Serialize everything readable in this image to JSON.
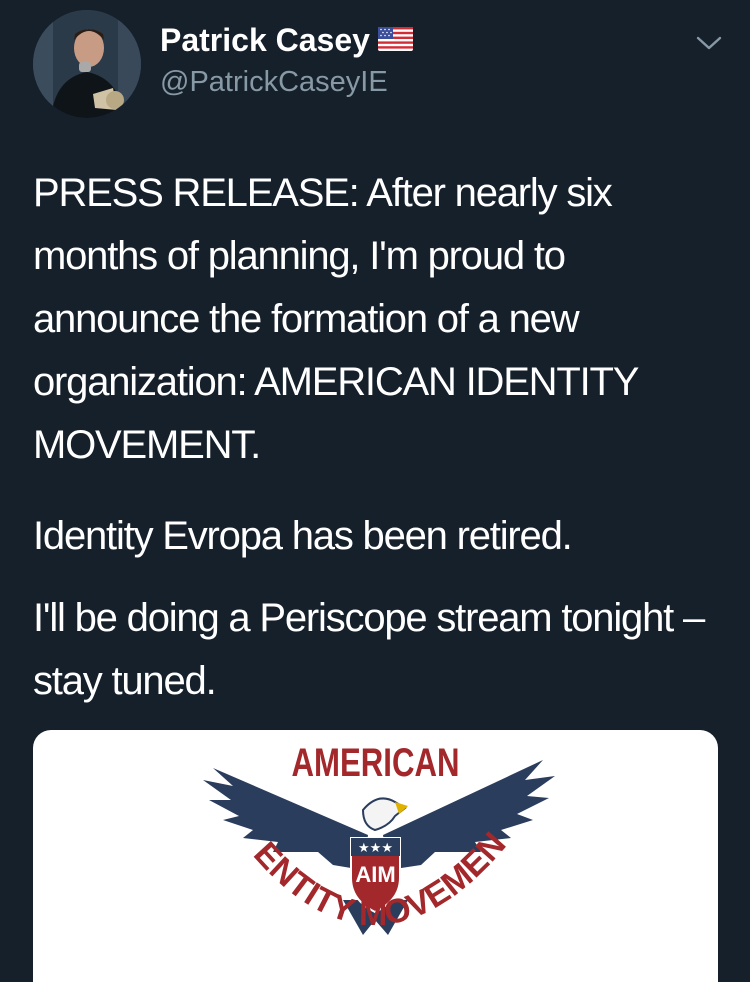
{
  "user": {
    "display_name": "Patrick Casey",
    "handle": "@PatrickCaseyIE",
    "flag_icon": "us-flag-icon"
  },
  "menu": {
    "icon": "chevron-down-icon"
  },
  "tweet": {
    "paragraphs": [
      "PRESS RELEASE: After nearly six months of planning, I'm proud to announce the formation of a new organization: AMERICAN IDENTITY MOVEMENT.",
      "Identity Evropa has been retired.",
      "I'll be doing a Periscope stream tonight – stay tuned."
    ]
  },
  "media": {
    "logo_top_text": "AMERICAN",
    "logo_shield_text": "AIM",
    "logo_stars": "★★★",
    "logo_arc_text": "IDENTITY MOVEMENT",
    "colors": {
      "navy": "#2b3d5c",
      "red": "#a3282c"
    }
  },
  "colors": {
    "background": "#15202b",
    "text": "#ffffff",
    "secondary_text": "#8899a6"
  }
}
